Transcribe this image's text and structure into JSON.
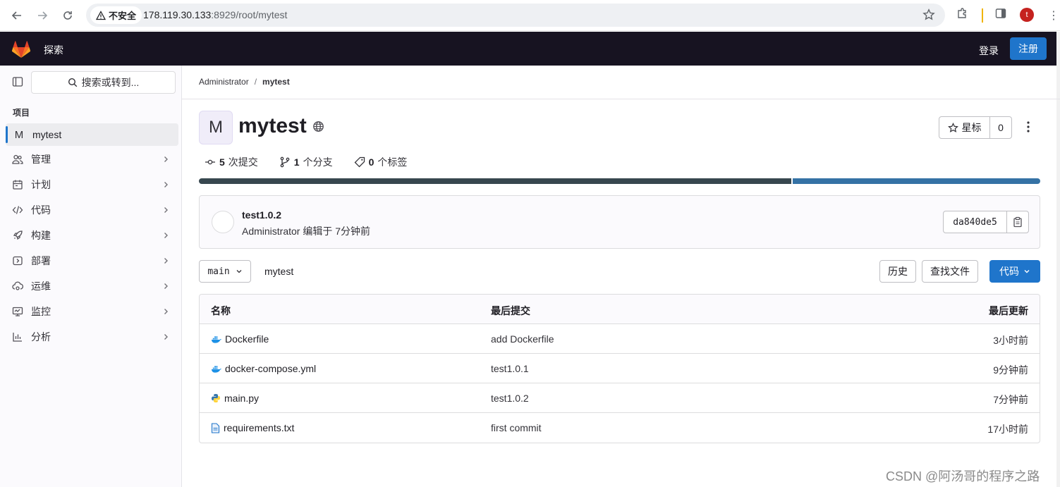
{
  "browser": {
    "insecure_label": "不安全",
    "url_host": "178.119.30.133",
    "url_rest": ":8929/root/mytest",
    "profile_initial": "t"
  },
  "topbar": {
    "explore": "探索",
    "login": "登录",
    "register": "注册"
  },
  "sidebar": {
    "search": "搜索或转到...",
    "section": "项目",
    "project": {
      "initial": "M",
      "name": "mytest"
    },
    "items": [
      {
        "label": "管理",
        "icon": "users-icon"
      },
      {
        "label": "计划",
        "icon": "calendar-icon"
      },
      {
        "label": "代码",
        "icon": "code-icon"
      },
      {
        "label": "构建",
        "icon": "rocket-icon"
      },
      {
        "label": "部署",
        "icon": "deploy-icon"
      },
      {
        "label": "运维",
        "icon": "cloud-gear-icon"
      },
      {
        "label": "监控",
        "icon": "monitor-icon"
      },
      {
        "label": "分析",
        "icon": "chart-icon"
      }
    ]
  },
  "breadcrumb": {
    "owner": "Administrator",
    "sep": "/",
    "project": "mytest"
  },
  "project": {
    "initial": "M",
    "name": "mytest",
    "star_label": "星标",
    "star_count": "0"
  },
  "stats": {
    "commits_num": "5",
    "commits_label": "次提交",
    "branches_num": "1",
    "branches_label": "个分支",
    "tags_num": "0",
    "tags_label": "个标签"
  },
  "language_bar": {
    "colors": [
      "#37474f",
      "#3572a5"
    ]
  },
  "last_commit": {
    "title": "test1.0.2",
    "author": "Administrator",
    "meta": "编辑于 7分钟前",
    "sha": "da840de5"
  },
  "repo": {
    "branch": "main",
    "path": "mytest",
    "history": "历史",
    "find_file": "查找文件",
    "code": "代码"
  },
  "table": {
    "headers": {
      "name": "名称",
      "last_commit": "最后提交",
      "last_update": "最后更新"
    },
    "rows": [
      {
        "name": "Dockerfile",
        "icon": "docker-icon",
        "commit": "add Dockerfile",
        "updated": "3小时前"
      },
      {
        "name": "docker-compose.yml",
        "icon": "docker-icon",
        "commit": "test1.0.1",
        "updated": "9分钟前"
      },
      {
        "name": "main.py",
        "icon": "python-icon",
        "commit": "test1.0.2",
        "updated": "7分钟前"
      },
      {
        "name": "requirements.txt",
        "icon": "file-text-icon",
        "commit": "first commit",
        "updated": "17小时前"
      }
    ]
  },
  "watermark": "CSDN @阿汤哥的程序之路"
}
